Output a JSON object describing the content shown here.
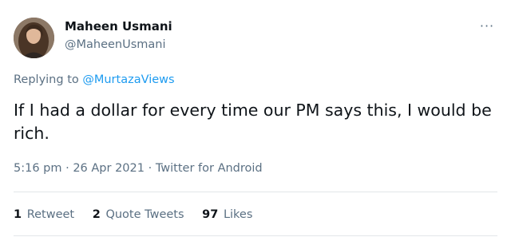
{
  "author": {
    "name": "Maheen Usmani",
    "handle": "@MaheenUsmani",
    "avatar_icon": "user-avatar-photo"
  },
  "more_menu": {
    "label": "···"
  },
  "reply": {
    "prefix": "Replying to ",
    "to": "@MurtazaViews"
  },
  "tweet": {
    "text": "If I had a dollar for every time our PM says this, I would be rich."
  },
  "meta": {
    "time": "5:16 pm",
    "date": "26 Apr 2021",
    "separator": " · ",
    "source": "Twitter for Android"
  },
  "stats": {
    "retweets": {
      "count": "1",
      "label": "Retweet"
    },
    "quotes": {
      "count": "2",
      "label": "Quote Tweets"
    },
    "likes": {
      "count": "97",
      "label": "Likes"
    }
  },
  "colors": {
    "link": "#1d9bf0",
    "secondary_text": "#5b7083",
    "primary_text": "#0f1419",
    "divider": "#e2e6e9"
  }
}
